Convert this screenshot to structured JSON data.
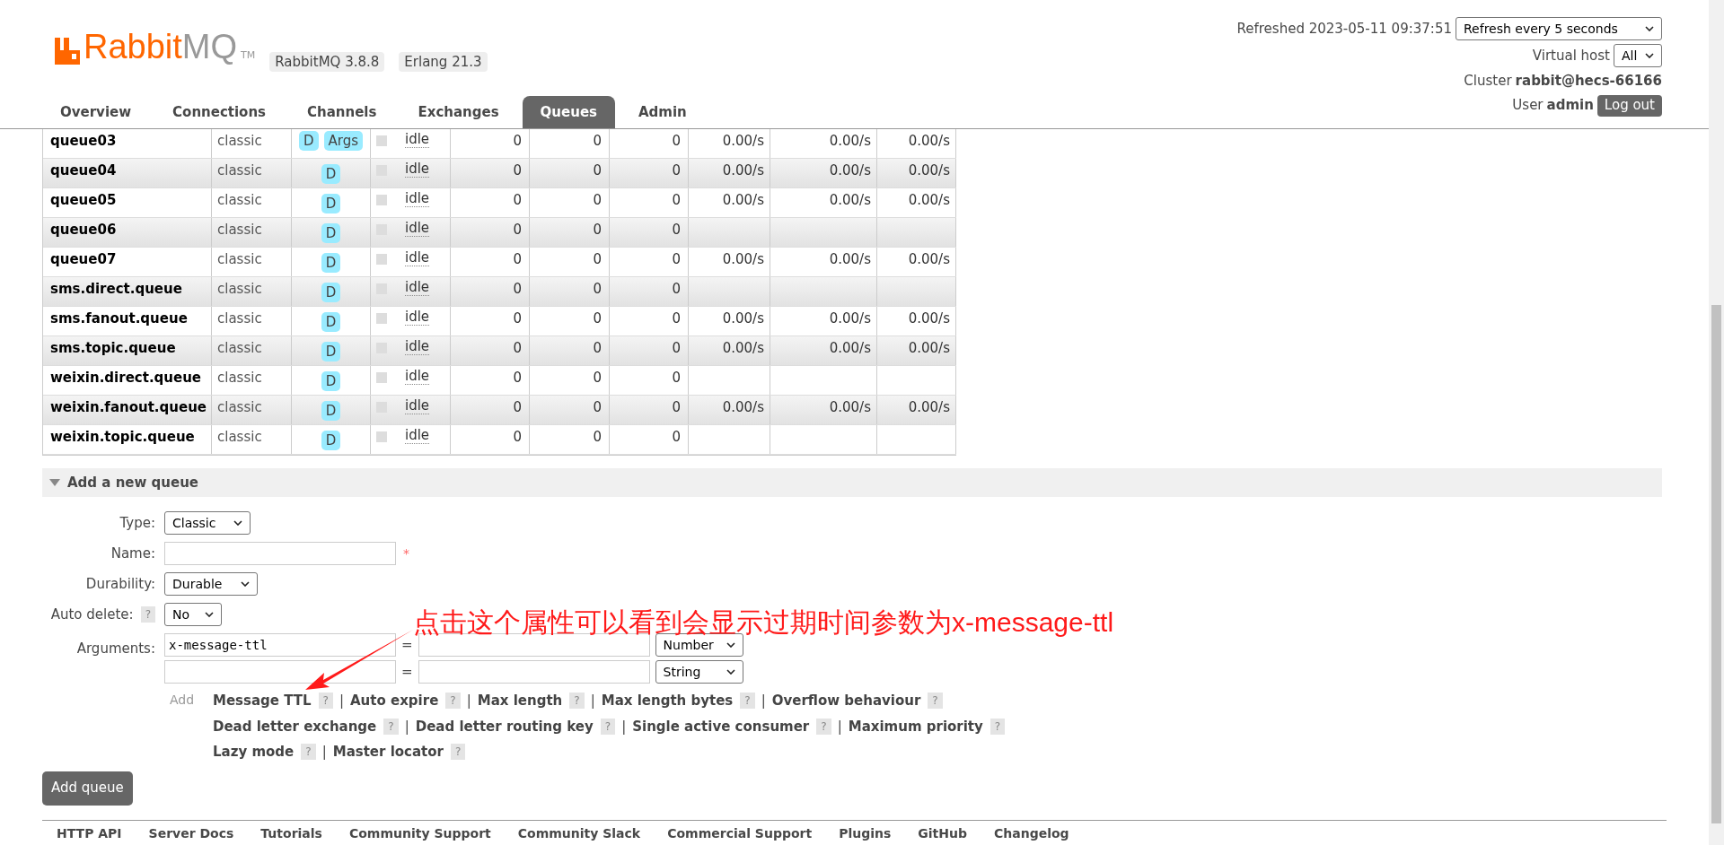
{
  "header": {
    "logo": {
      "part1": "Rabbit",
      "part2": "MQ",
      "mark": "TM"
    },
    "badges": [
      "RabbitMQ 3.8.8",
      "Erlang 21.3"
    ],
    "refreshed": "Refreshed 2023-05-11 09:37:51",
    "refresh_select": "Refresh every 5 seconds",
    "virtual_host": {
      "label": "Virtual host",
      "value": "All"
    },
    "cluster": {
      "label": "Cluster",
      "value": "rabbit@hecs-66166"
    },
    "user": {
      "label": "User",
      "value": "admin"
    },
    "logout": "Log out"
  },
  "tabs": [
    {
      "label": "Overview",
      "selected": false
    },
    {
      "label": "Connections",
      "selected": false
    },
    {
      "label": "Channels",
      "selected": false
    },
    {
      "label": "Exchanges",
      "selected": false
    },
    {
      "label": "Queues",
      "selected": true
    },
    {
      "label": "Admin",
      "selected": false
    }
  ],
  "table": {
    "rows": [
      {
        "name": "queue03",
        "type": "classic",
        "features": [
          "D",
          "Args"
        ],
        "state": "idle",
        "counts": [
          "0",
          "0",
          "0"
        ],
        "rates": [
          "0.00/s",
          "0.00/s",
          "0.00/s"
        ]
      },
      {
        "name": "queue04",
        "type": "classic",
        "features": [
          "D"
        ],
        "state": "idle",
        "counts": [
          "0",
          "0",
          "0"
        ],
        "rates": [
          "0.00/s",
          "0.00/s",
          "0.00/s"
        ]
      },
      {
        "name": "queue05",
        "type": "classic",
        "features": [
          "D"
        ],
        "state": "idle",
        "counts": [
          "0",
          "0",
          "0"
        ],
        "rates": [
          "0.00/s",
          "0.00/s",
          "0.00/s"
        ]
      },
      {
        "name": "queue06",
        "type": "classic",
        "features": [
          "D"
        ],
        "state": "idle",
        "counts": [
          "0",
          "0",
          "0"
        ],
        "rates": []
      },
      {
        "name": "queue07",
        "type": "classic",
        "features": [
          "D"
        ],
        "state": "idle",
        "counts": [
          "0",
          "0",
          "0"
        ],
        "rates": [
          "0.00/s",
          "0.00/s",
          "0.00/s"
        ]
      },
      {
        "name": "sms.direct.queue",
        "type": "classic",
        "features": [
          "D"
        ],
        "state": "idle",
        "counts": [
          "0",
          "0",
          "0"
        ],
        "rates": []
      },
      {
        "name": "sms.fanout.queue",
        "type": "classic",
        "features": [
          "D"
        ],
        "state": "idle",
        "counts": [
          "0",
          "0",
          "0"
        ],
        "rates": [
          "0.00/s",
          "0.00/s",
          "0.00/s"
        ]
      },
      {
        "name": "sms.topic.queue",
        "type": "classic",
        "features": [
          "D"
        ],
        "state": "idle",
        "counts": [
          "0",
          "0",
          "0"
        ],
        "rates": [
          "0.00/s",
          "0.00/s",
          "0.00/s"
        ]
      },
      {
        "name": "weixin.direct.queue",
        "type": "classic",
        "features": [
          "D"
        ],
        "state": "idle",
        "counts": [
          "0",
          "0",
          "0"
        ],
        "rates": []
      },
      {
        "name": "weixin.fanout.queue",
        "type": "classic",
        "features": [
          "D"
        ],
        "state": "idle",
        "counts": [
          "0",
          "0",
          "0"
        ],
        "rates": [
          "0.00/s",
          "0.00/s",
          "0.00/s"
        ]
      },
      {
        "name": "weixin.topic.queue",
        "type": "classic",
        "features": [
          "D"
        ],
        "state": "idle",
        "counts": [
          "0",
          "0",
          "0"
        ],
        "rates": []
      }
    ]
  },
  "add_section": {
    "title": "Add a new queue",
    "expanded": true,
    "fields": [
      {
        "label": "Type:",
        "kind": "select",
        "value": "Classic"
      },
      {
        "label": "Name:",
        "kind": "text",
        "required": "*"
      },
      {
        "label": "Durability:",
        "kind": "select",
        "value": "Durable"
      },
      {
        "label": "Auto delete:",
        "help": "?",
        "kind": "select",
        "value": "No"
      }
    ],
    "arguments": {
      "label": "Arguments:",
      "rows": [
        {
          "key": "x-message-ttl",
          "equals": "=",
          "type": "Number"
        },
        {
          "equals": "=",
          "type": "String"
        }
      ]
    },
    "add_label": "Add",
    "arg_links": [
      [
        {
          "label": "Message TTL",
          "help": "?"
        },
        {
          "label": "Auto expire",
          "help": "?"
        },
        {
          "label": "Max length",
          "help": "?"
        },
        {
          "label": "Max length bytes",
          "help": "?"
        },
        {
          "label": "Overflow behaviour",
          "help": "?"
        }
      ],
      [
        {
          "label": "Dead letter exchange",
          "help": "?"
        },
        {
          "label": "Dead letter routing key",
          "help": "?"
        },
        {
          "label": "Single active consumer",
          "help": "?"
        },
        {
          "label": "Maximum priority",
          "help": "?"
        }
      ],
      [
        {
          "label": "Lazy mode",
          "help": "?"
        },
        {
          "label": "Master locator",
          "help": "?"
        }
      ]
    ],
    "separator": "|",
    "submit": "Add queue"
  },
  "annotation": "点击这个属性可以看到会显示过期时间参数为x-message-ttl",
  "footer": [
    "HTTP API",
    "Server Docs",
    "Tutorials",
    "Community Support",
    "Community Slack",
    "Commercial Support",
    "Plugins",
    "GitHub",
    "Changelog"
  ]
}
